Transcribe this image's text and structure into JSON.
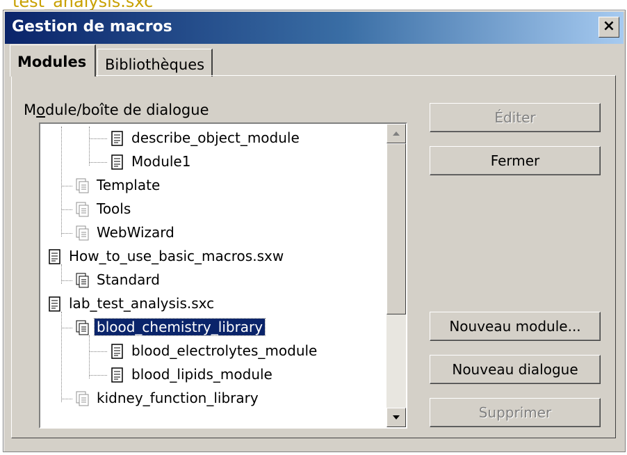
{
  "background": {
    "partial_text": "_test_analysis.sxc"
  },
  "window": {
    "title": "Gestion de macros",
    "close_glyph": "×"
  },
  "tabs": [
    {
      "label": "Modules",
      "active": true
    },
    {
      "label": "Bibliothèques",
      "active": false
    }
  ],
  "tree": {
    "group_label_prefix": "M",
    "group_label_mnemonic": "o",
    "group_label_rest": "dule/boîte de dialogue",
    "items": [
      {
        "label": "describe_object_module",
        "kind": "module",
        "level": 3
      },
      {
        "label": "Module1",
        "kind": "module",
        "level": 3
      },
      {
        "label": "Template",
        "kind": "library",
        "level": 2,
        "dimmed": true
      },
      {
        "label": "Tools",
        "kind": "library",
        "level": 2,
        "dimmed": true
      },
      {
        "label": "WebWizard",
        "kind": "library",
        "level": 2,
        "dimmed": true
      },
      {
        "label": "How_to_use_basic_macros.sxw",
        "kind": "document",
        "level": 1
      },
      {
        "label": "Standard",
        "kind": "library",
        "level": 2
      },
      {
        "label": "lab_test_analysis.sxc",
        "kind": "document",
        "level": 1
      },
      {
        "label": "blood_chemistry_library",
        "kind": "library",
        "level": 2,
        "selected": true
      },
      {
        "label": "blood_electrolytes_module",
        "kind": "module",
        "level": 3
      },
      {
        "label": "blood_lipids_module",
        "kind": "module",
        "level": 3
      },
      {
        "label": "kidney_function_library",
        "kind": "library",
        "level": 2,
        "dimmed": true
      }
    ]
  },
  "buttons": {
    "edit": {
      "label": "Éditer",
      "enabled": false
    },
    "close": {
      "label": "Fermer",
      "enabled": true
    },
    "new_module": {
      "label": "Nouveau module...",
      "enabled": true
    },
    "new_dialog": {
      "label": "Nouveau dialogue",
      "enabled": true
    },
    "delete": {
      "label": "Supprimer",
      "enabled": false
    }
  },
  "colors": {
    "title_gradient_start": "#0a246a",
    "selection": "#0a246a",
    "face": "#d4d0c8"
  }
}
